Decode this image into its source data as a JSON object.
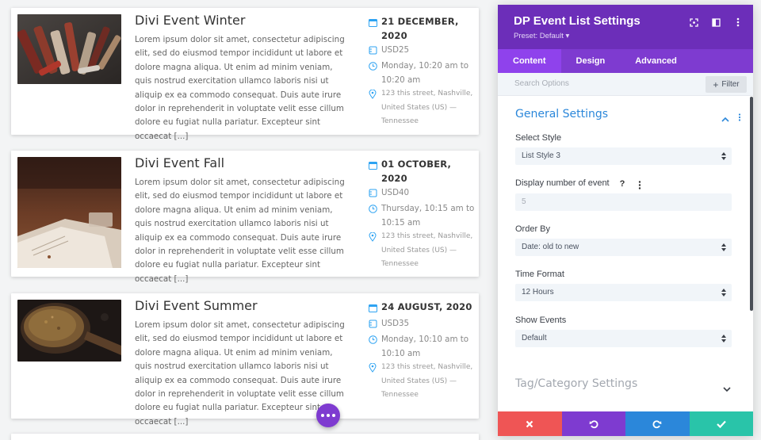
{
  "events": [
    {
      "title": "Divi Event Winter",
      "description": "Lorem ipsum dolor sit amet, consectetur adipiscing elit, sed do eiusmod tempor incididunt ut labore et dolore magna aliqua. Ut enim ad minim veniam, quis nostrud exercitation ullamco laboris nisi ut aliquip ex ea commodo consequat. Duis aute irure dolor in reprehenderit in voluptate velit esse cillum dolore eu fugiat nulla pariatur. Excepteur sint occaecat [...]",
      "date": "21 DECEMBER, 2020",
      "price": "USD25",
      "time": "Monday, 10:20 am to 10:20 am",
      "address": "123 this street, Nashville, United States (US) — Tennessee",
      "image": "tools-photo"
    },
    {
      "title": "Divi Event Fall",
      "description": "Lorem ipsum dolor sit amet, consectetur adipiscing elit, sed do eiusmod tempor incididunt ut labore et dolore magna aliqua. Ut enim ad minim veniam, quis nostrud exercitation ullamco laboris nisi ut aliquip ex ea commodo consequat. Duis aute irure dolor in reprehenderit in voluptate velit esse cillum dolore eu fugiat nulla pariatur. Excepteur sint occaecat [...]",
      "date": "01 OCTOBER, 2020",
      "price": "USD40",
      "time": "Thursday, 10:15 am to 10:15 am",
      "address": "123 this street, Nashville, United States (US) — Tennessee",
      "image": "book-table-photo"
    },
    {
      "title": "Divi Event Summer",
      "description": "Lorem ipsum dolor sit amet, consectetur adipiscing elit, sed do eiusmod tempor incididunt ut labore et dolore magna aliqua. Ut enim ad minim veniam, quis nostrud exercitation ullamco laboris nisi ut aliquip ex ea commodo consequat. Duis aute irure dolor in reprehenderit in voluptate velit esse cillum dolore eu fugiat nulla pariatur. Excepteur sint occaecat [...]",
      "date": "24 AUGUST, 2020",
      "price": "USD35",
      "time": "Monday, 10:10 am to 10:10 am",
      "address": "123 this street, Nashville, United States (US) — Tennessee",
      "image": "spice-spoon-photo"
    }
  ],
  "icons": {
    "date": "calendar-icon",
    "price": "ticket-icon",
    "time": "clock-icon",
    "address": "location-pin-icon",
    "fab": "more-dots-icon"
  },
  "panel": {
    "title": "DP Event List Settings",
    "preset": "Preset: Default ▾",
    "header_icons": [
      "focus-icon",
      "sidebar-toggle-icon",
      "kebab-menu-icon"
    ],
    "tabs": [
      "Content",
      "Design",
      "Advanced"
    ],
    "active_tab": "Content",
    "search_placeholder": "Search Options",
    "filter_label": "Filter",
    "section_general": "General Settings",
    "fields": {
      "select_style": {
        "label": "Select Style",
        "value": "List Style 3"
      },
      "display_number": {
        "label": "Display number of event",
        "value": "5"
      },
      "order_by": {
        "label": "Order By",
        "value": "Date: old to new"
      },
      "time_format": {
        "label": "Time Format",
        "value": "12 Hours"
      },
      "show_events": {
        "label": "Show Events",
        "value": "Default"
      }
    },
    "section_tag": "Tag/Category Settings",
    "help_glyph": "?",
    "footer": [
      "close-icon",
      "undo-icon",
      "redo-icon",
      "save-check-icon"
    ]
  },
  "colors": {
    "purple_dark": "#6c2eb9",
    "purple": "#7e3bd0",
    "blue": "#2b87da",
    "red": "#ef5555",
    "green": "#29c4a9",
    "meta_icon": "#2ea3f2"
  }
}
